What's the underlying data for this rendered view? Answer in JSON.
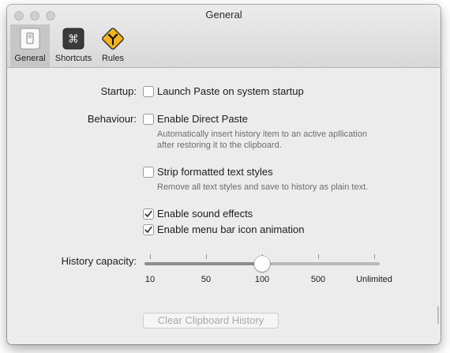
{
  "window": {
    "title": "General"
  },
  "toolbar": {
    "tabs": [
      {
        "label": "General",
        "icon": "switch-icon",
        "selected": true
      },
      {
        "label": "Shortcuts",
        "icon": "command-key-icon",
        "selected": false
      },
      {
        "label": "Rules",
        "icon": "road-sign-icon",
        "selected": false
      }
    ]
  },
  "settings": {
    "startup": {
      "label": "Startup:",
      "checkbox_label": "Launch Paste on system startup",
      "checked": false
    },
    "behaviour": {
      "label": "Behaviour:",
      "direct_paste": {
        "label": "Enable Direct Paste",
        "checked": false,
        "description_line1": "Automatically insert history item to an active apllication",
        "description_line2": "after restoring it to the clipboard."
      },
      "strip_styles": {
        "label": "Strip formatted text styles",
        "checked": false,
        "description": "Remove all text styles and save to history as plain text."
      }
    },
    "sound_effects": {
      "label": "Enable sound effects",
      "checked": true
    },
    "menu_bar_animation": {
      "label": "Enable menu bar icon animation",
      "checked": true
    },
    "history_capacity": {
      "label": "History capacity:",
      "ticks": [
        "10",
        "50",
        "100",
        "500",
        "Unlimited"
      ],
      "selected": "100",
      "selected_index": 2
    },
    "clear_button": {
      "label": "Clear Clipboard History",
      "enabled": false
    }
  },
  "colors": {
    "road_sign": "#f3b41b",
    "command_key": "#3a3a3a",
    "checkmark": "#3d3d3d"
  }
}
